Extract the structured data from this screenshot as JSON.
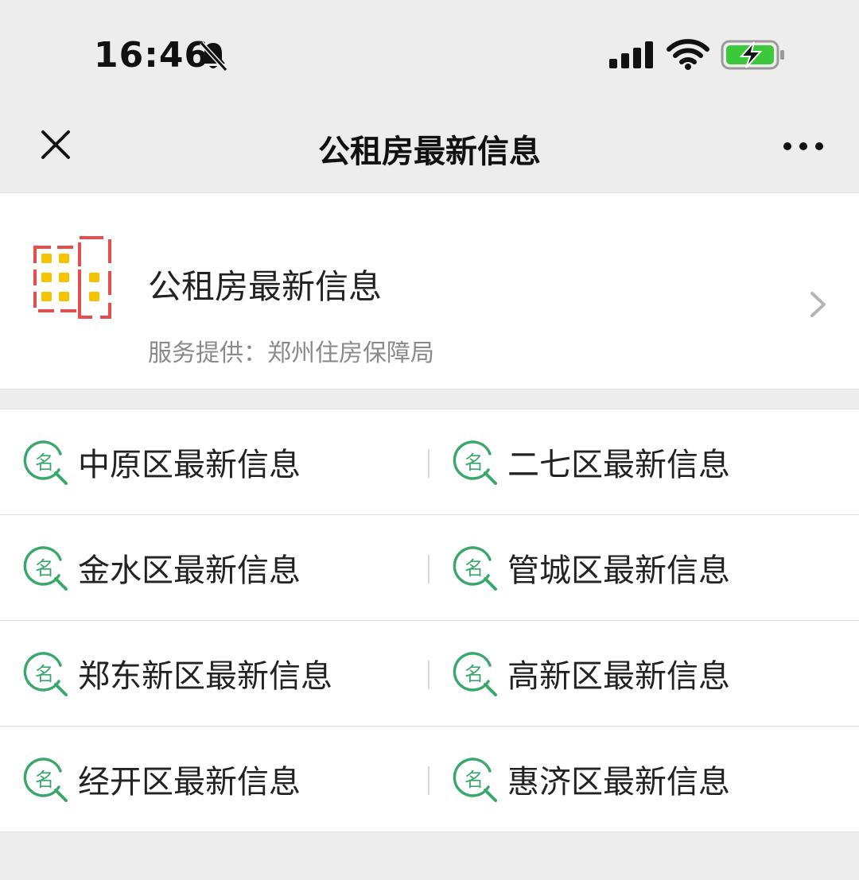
{
  "status_bar": {
    "time": "16:46",
    "icons": [
      "bell-muted-icon",
      "signal-icon",
      "wifi-icon",
      "battery-charging-icon"
    ],
    "battery_color": "#3cc83c"
  },
  "nav": {
    "title": "公租房最新信息",
    "close_icon": "close-icon",
    "more_icon": "more-icon"
  },
  "service": {
    "name": "公租房最新信息",
    "provider": "服务提供：郑州住房保障局",
    "logo_colors": {
      "frame": "#e84c4c",
      "windows": "#f5c400"
    }
  },
  "links": {
    "icon_color": "#3aa86b",
    "rows": [
      [
        {
          "label": "中原区最新信息"
        },
        {
          "label": "二七区最新信息"
        }
      ],
      [
        {
          "label": "金水区最新信息"
        },
        {
          "label": "管城区最新信息"
        }
      ],
      [
        {
          "label": "郑东新区最新信息"
        },
        {
          "label": "高新区最新信息"
        }
      ],
      [
        {
          "label": "经开区最新信息"
        },
        {
          "label": "惠济区最新信息"
        }
      ]
    ]
  }
}
